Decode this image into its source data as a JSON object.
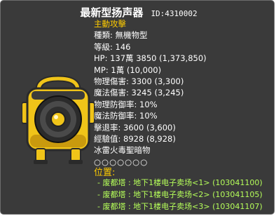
{
  "header": {
    "mob_name": "最新型扬声器",
    "mob_id": "ID:4310002"
  },
  "stats": {
    "aggressive": "主動攻擊",
    "type": "種類: 無機物型",
    "level": "等級: 146",
    "hp": "HP: 137萬 3850 (1,373,850)",
    "mp": "MP: 1萬 (10,000)",
    "physical_damage": "物理傷害: 3300 (3,300)",
    "magic_damage": "魔法傷害: 3245 (3,245)",
    "physical_defense": "物理防御率: 10%",
    "magic_defense": "魔法防御率: 10%",
    "knockback": "擊退率: 3600 (3,600)",
    "exp": "經驗值: 8928 (8,928)",
    "elements": "冰雷火毒聖暗物",
    "element_marks": "○○○○○○○"
  },
  "location": {
    "label": "位置:",
    "entries": [
      "- 废都塔 : 地下1楼电子卖场<1> (103041100)",
      "- 废都塔 : 地下1楼电子卖场<2> (103041105)",
      "- 废都塔 : 地下1楼电子卖场<3> (103041107)"
    ]
  },
  "colors": {
    "panel_background": "#3a3a3a",
    "title_text": "#ffffff",
    "highlight_yellow": "#ffcc00",
    "location_green": "#b6ff5a",
    "speaker_body": "#f0c419",
    "speaker_dark": "#2a2a2a"
  },
  "image": {
    "icon": "speaker-monster-icon"
  }
}
